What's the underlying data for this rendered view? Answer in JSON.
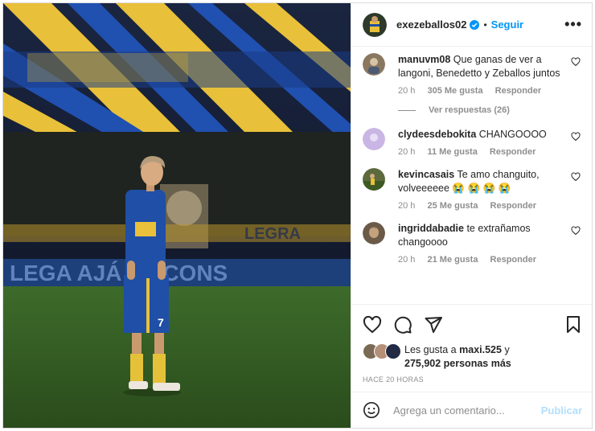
{
  "post": {
    "username": "exezeballos02",
    "separator": "•",
    "follow_label": "Seguir",
    "more_label": "•••",
    "photo_banner_text": "LEGA AJÁ EL CONS",
    "jersey_number": "7"
  },
  "comments": [
    {
      "user": "manuvm08",
      "text": "Que ganas de ver a langoni, Benedetto y Zeballos juntos",
      "time": "20 h",
      "likes": "305 Me gusta",
      "reply": "Responder",
      "view_replies": "Ver respuestas (26)",
      "avatar_color": "#8a7760"
    },
    {
      "user": "clydeesdebokita",
      "text": "CHANGOOOO",
      "time": "20 h",
      "likes": "11 Me gusta",
      "reply": "Responder",
      "avatar_color": "#c9b6e4"
    },
    {
      "user": "kevincasais",
      "text": "Te amo changuito, volveeeeee 😭 😭 😭 😭",
      "time": "20 h",
      "likes": "25 Me gusta",
      "reply": "Responder",
      "avatar_color": "#5c6a3e"
    },
    {
      "user": "ingriddabadie",
      "text": "te extrañamos changoooo",
      "time": "20 h",
      "likes": "21 Me gusta",
      "reply": "Responder",
      "avatar_color": "#6b5a48"
    }
  ],
  "likes": {
    "prefix": "Les gusta a",
    "user": "maxi.525",
    "mid": "y",
    "count": "275,902 personas más"
  },
  "posted_ago": "HACE 20 HORAS",
  "add_comment": {
    "placeholder": "Agrega un comentario...",
    "publish_label": "Publicar"
  },
  "colors": {
    "accent": "#0095f6",
    "publish_disabled": "#b2dffc",
    "boca_blue": "#1f4fa6",
    "boca_gold": "#e8c03a"
  }
}
